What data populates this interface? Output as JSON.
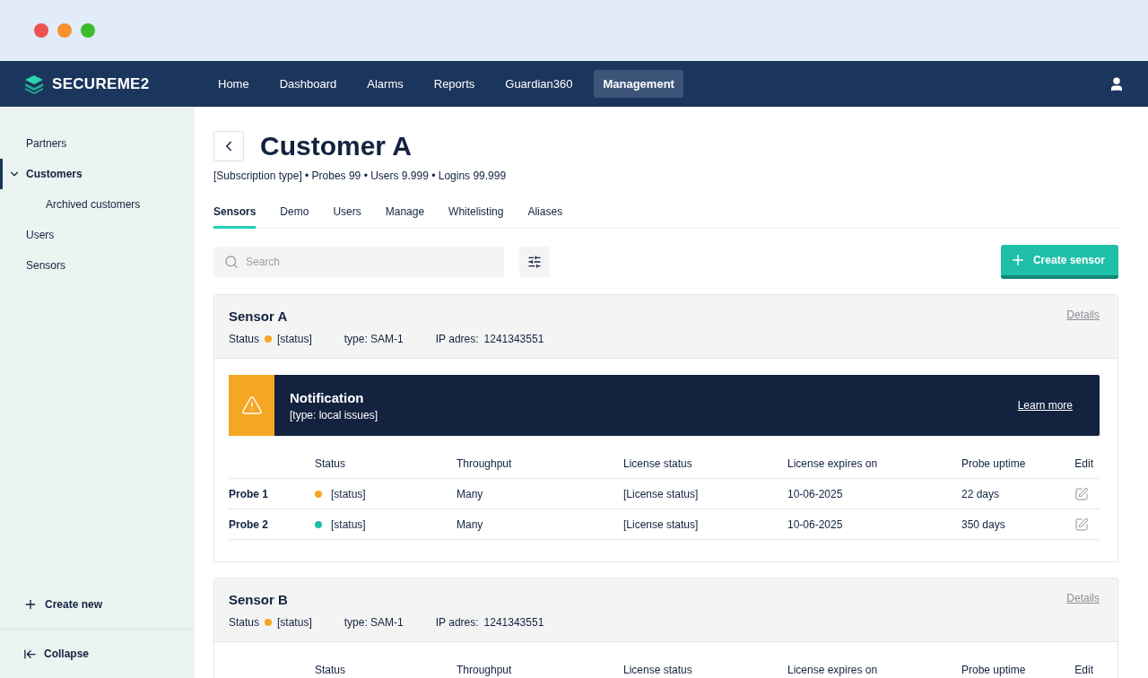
{
  "brand": {
    "name": "SECUREME2"
  },
  "nav": [
    {
      "label": "Home",
      "selected": false
    },
    {
      "label": "Dashboard",
      "selected": false
    },
    {
      "label": "Alarms",
      "selected": false
    },
    {
      "label": "Reports",
      "selected": false
    },
    {
      "label": "Guardian360",
      "selected": false
    },
    {
      "label": "Management",
      "selected": true
    }
  ],
  "sidebar": {
    "items": [
      {
        "label": "Partners",
        "selected": false
      },
      {
        "label": "Customers",
        "selected": true,
        "expanded": true,
        "children": [
          {
            "label": "Archived customers",
            "selected": false
          }
        ]
      },
      {
        "label": "Users",
        "selected": false
      },
      {
        "label": "Sensors",
        "selected": false
      }
    ],
    "create_new": "Create new",
    "collapse": "Collapse"
  },
  "page": {
    "title": "Customer A",
    "subtitle": "[Subscription type] • Probes 99 • Users 9.999 • Logins 99.999"
  },
  "tabs": [
    {
      "label": "Sensors",
      "selected": true
    },
    {
      "label": "Demo",
      "selected": false
    },
    {
      "label": "Users",
      "selected": false
    },
    {
      "label": "Manage",
      "selected": false
    },
    {
      "label": "Whitelisting",
      "selected": false
    },
    {
      "label": "Aliases",
      "selected": false
    }
  ],
  "search": {
    "placeholder": "Search"
  },
  "create_button": "Create sensor",
  "sensors": [
    {
      "name": "Sensor A",
      "details": "Details",
      "status_label": "Status",
      "status": "[status]",
      "color": "#f5a623",
      "type": "type: SAM-1",
      "ip_label": "IP adres:",
      "ip": "1241343551",
      "notification": {
        "title": "Notification",
        "text": "[type: local issues]",
        "link": "Learn more"
      },
      "columns": [
        "Status",
        "Throughput",
        "License status",
        "License expires on",
        "Probe uptime",
        "Edit"
      ],
      "probes": [
        {
          "name": "Probe 1",
          "status": "[status]",
          "color": "#f5a623",
          "throughput": "Many",
          "license": "[License status]",
          "expires": "10-06-2025",
          "uptime": "22 days"
        },
        {
          "name": "Probe 2",
          "status": "[status]",
          "color": "#1fbfa6",
          "throughput": "Many",
          "license": "[License status]",
          "expires": "10-06-2025",
          "uptime": "350 days"
        }
      ]
    },
    {
      "name": "Sensor B",
      "details": "Details",
      "status_label": "Status",
      "status": "[status]",
      "color": "#f5a623",
      "type": "type: SAM-1",
      "ip_label": "IP adres:",
      "ip": "1241343551",
      "columns": [
        "Status",
        "Throughput",
        "License status",
        "License expires on",
        "Probe uptime",
        "Edit"
      ]
    }
  ]
}
